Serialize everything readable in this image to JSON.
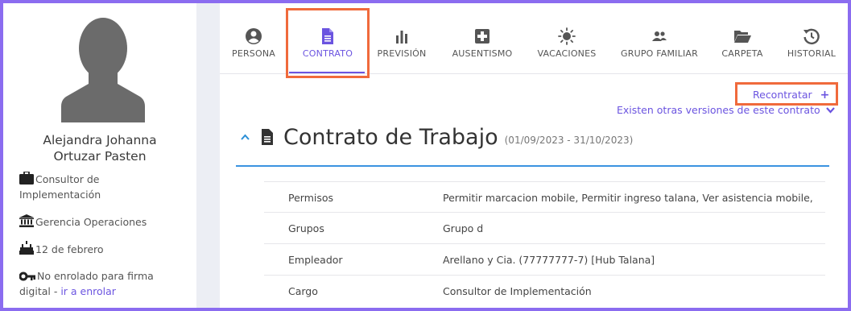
{
  "profile": {
    "name_line1": "Alejandra Johanna",
    "name_line2": "Ortuzar Pasten",
    "position_line1": "Consultor de",
    "position_line2": "Implementación",
    "department": "Gerencia Operaciones",
    "birthday": "12 de febrero",
    "signature_line1": "No enrolado para firma",
    "signature_line2_prefix": "digital - ",
    "enroll_link": "ir a enrolar"
  },
  "tabs": [
    {
      "label": "PERSONA",
      "icon": "person-circle-icon"
    },
    {
      "label": "CONTRATO",
      "icon": "document-icon",
      "active": true
    },
    {
      "label": "PREVISIÓN",
      "icon": "bar-chart-icon"
    },
    {
      "label": "AUSENTISMO",
      "icon": "medical-cross-icon"
    },
    {
      "label": "VACACIONES",
      "icon": "sun-icon"
    },
    {
      "label": "GRUPO FAMILIAR",
      "icon": "group-icon"
    },
    {
      "label": "CARPETA",
      "icon": "folder-open-icon"
    },
    {
      "label": "HISTORIAL",
      "icon": "history-icon"
    }
  ],
  "actions": {
    "recontratar": "Recontratar",
    "versions": "Existen otras versiones de este contrato"
  },
  "contract": {
    "title": "Contrato de Trabajo",
    "dates": "(01/09/2023 - 31/10/2023)",
    "rows": [
      {
        "key": "Permisos",
        "value": "Permitir marcacion mobile, Permitir ingreso talana, Ver asistencia mobile,"
      },
      {
        "key": "Grupos",
        "value": "Grupo d"
      },
      {
        "key": "Empleador",
        "value": "Arellano y Cia. (77777777-7) [Hub Talana]"
      },
      {
        "key": "Cargo",
        "value": "Consultor de Implementación"
      }
    ]
  },
  "colors": {
    "accent": "#6b54e0",
    "highlight": "#f06a3c",
    "rule": "#3b93e0",
    "frame": "#8b6cf0"
  }
}
